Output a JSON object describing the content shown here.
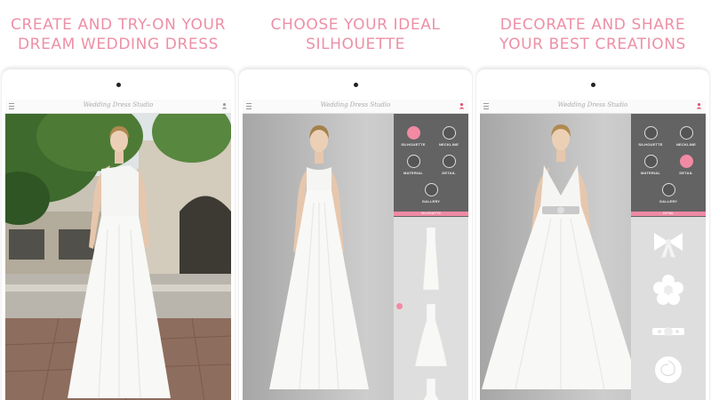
{
  "panels": [
    {
      "headline": "CREATE AND TRY-ON YOUR\nDREAM WEDDING DRESS",
      "app_title": "Wedding Dress Studio"
    },
    {
      "headline": "CHOOSE YOUR IDEAL\nSILHOUETTE",
      "app_title": "Wedding Dress Studio",
      "options": [
        "SILHOUETTE",
        "NECKLINE",
        "MATERIAL",
        "DETAIL",
        "GALLERY"
      ],
      "selected_option": "SILHOUETTE",
      "section_label": "SILHOUETTE",
      "list_items": [
        "sheath-dress-thumbnail",
        "a-line-dress-thumbnail",
        "ballgown-dress-thumbnail"
      ]
    },
    {
      "headline": "DECORATE AND SHARE\nYOUR BEST CREATIONS",
      "app_title": "Wedding Dress Studio",
      "options": [
        "SILHOUETTE",
        "NECKLINE",
        "MATERIAL",
        "DETAIL",
        "GALLERY"
      ],
      "selected_option": "DETAIL",
      "section_label": "DETAIL",
      "list_items": [
        "bow-detail",
        "flower-detail",
        "brooch-belt-detail",
        "rose-detail"
      ]
    }
  ],
  "colors": {
    "accent_pink": "#ee8fa6",
    "sidebar_grey": "#636363",
    "list_grey": "#dedede"
  }
}
